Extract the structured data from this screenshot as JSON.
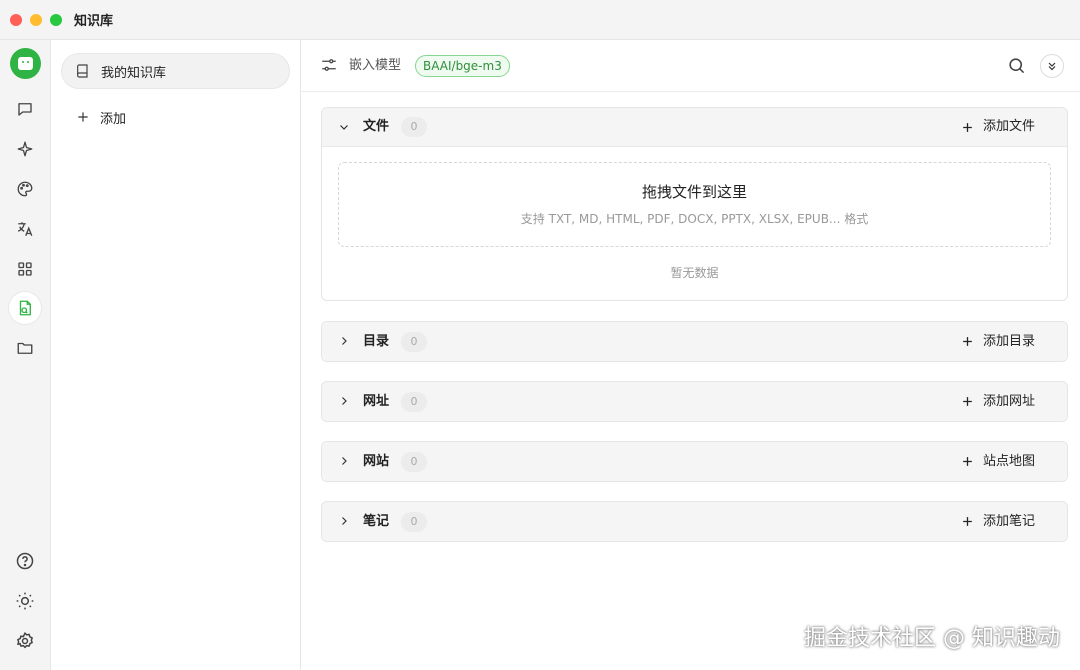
{
  "window": {
    "title": "知识库"
  },
  "rail": {
    "items": [
      {
        "icon": "chat-icon"
      },
      {
        "icon": "sparkle-icon"
      },
      {
        "icon": "palette-icon"
      },
      {
        "icon": "translate-icon"
      },
      {
        "icon": "apps-grid-icon"
      },
      {
        "icon": "knowledge-base-icon",
        "active": true
      },
      {
        "icon": "folder-icon"
      }
    ],
    "bottom": [
      {
        "icon": "help-icon"
      },
      {
        "icon": "theme-sun-icon"
      },
      {
        "icon": "settings-gear-icon"
      }
    ]
  },
  "kb_list": {
    "selected_label": "我的知识库",
    "add_label": "添加"
  },
  "header": {
    "embed_label": "嵌入模型",
    "model_tag": "BAAI/bge-m3"
  },
  "sections": {
    "files": {
      "title": "文件",
      "count": "0",
      "action": "添加文件",
      "drop_title": "拖拽文件到这里",
      "drop_sub": "支持 TXT, MD, HTML, PDF, DOCX, PPTX, XLSX, EPUB... 格式",
      "empty": "暂无数据"
    },
    "dirs": {
      "title": "目录",
      "count": "0",
      "action": "添加目录"
    },
    "urls": {
      "title": "网址",
      "count": "0",
      "action": "添加网址"
    },
    "sites": {
      "title": "网站",
      "count": "0",
      "action": "站点地图"
    },
    "notes": {
      "title": "笔记",
      "count": "0",
      "action": "添加笔记"
    }
  },
  "watermark": "掘金技术社区 @ 知识趣动",
  "colors": {
    "accent": "#2fb344",
    "tag_border": "#86d68f",
    "tag_text": "#2f8f3a"
  }
}
